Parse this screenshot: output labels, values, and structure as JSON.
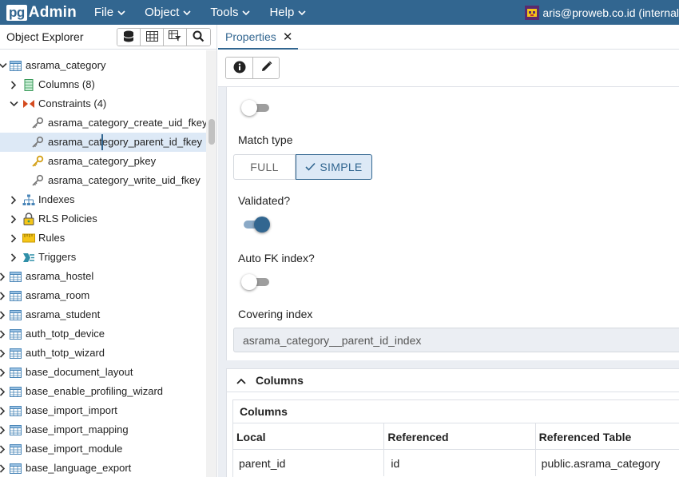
{
  "app": {
    "logo_pg": "pg",
    "logo_admin": "Admin"
  },
  "menu": [
    {
      "label": "File"
    },
    {
      "label": "Object"
    },
    {
      "label": "Tools"
    },
    {
      "label": "Help"
    }
  ],
  "user": {
    "label": "aris@proweb.co.id (internal"
  },
  "explorer": {
    "title": "Object Explorer",
    "tree": [
      {
        "label": "asrama_category",
        "indent": 0,
        "toggle": "open",
        "icon": "table-icon"
      },
      {
        "label": "Columns",
        "count": "(8)",
        "indent": 1,
        "toggle": "closed",
        "icon": "columns-icon"
      },
      {
        "label": "Constraints",
        "count": "(4)",
        "indent": 1,
        "toggle": "open",
        "icon": "constraints-icon"
      },
      {
        "label": "asrama_category_create_uid_fkey",
        "indent": 2,
        "toggle": "none",
        "icon": "foreign-key-icon"
      },
      {
        "label": "asrama_category_parent_id_fkey",
        "indent": 2,
        "toggle": "none",
        "icon": "foreign-key-icon",
        "selected": true
      },
      {
        "label": "asrama_category_pkey",
        "indent": 2,
        "toggle": "none",
        "icon": "primary-key-icon"
      },
      {
        "label": "asrama_category_write_uid_fkey",
        "indent": 2,
        "toggle": "none",
        "icon": "foreign-key-icon"
      },
      {
        "label": "Indexes",
        "indent": 1,
        "toggle": "closed",
        "icon": "indexes-icon"
      },
      {
        "label": "RLS Policies",
        "indent": 1,
        "toggle": "closed",
        "icon": "rls-policy-icon"
      },
      {
        "label": "Rules",
        "indent": 1,
        "toggle": "closed",
        "icon": "rules-icon"
      },
      {
        "label": "Triggers",
        "indent": 1,
        "toggle": "closed",
        "icon": "triggers-icon"
      },
      {
        "label": "asrama_hostel",
        "indent": 0,
        "toggle": "closed",
        "icon": "table-icon"
      },
      {
        "label": "asrama_room",
        "indent": 0,
        "toggle": "closed",
        "icon": "table-icon"
      },
      {
        "label": "asrama_student",
        "indent": 0,
        "toggle": "closed",
        "icon": "table-icon"
      },
      {
        "label": "auth_totp_device",
        "indent": 0,
        "toggle": "closed",
        "icon": "table-icon"
      },
      {
        "label": "auth_totp_wizard",
        "indent": 0,
        "toggle": "closed",
        "icon": "table-icon"
      },
      {
        "label": "base_document_layout",
        "indent": 0,
        "toggle": "closed",
        "icon": "table-icon"
      },
      {
        "label": "base_enable_profiling_wizard",
        "indent": 0,
        "toggle": "closed",
        "icon": "table-icon"
      },
      {
        "label": "base_import_import",
        "indent": 0,
        "toggle": "closed",
        "icon": "table-icon"
      },
      {
        "label": "base_import_mapping",
        "indent": 0,
        "toggle": "closed",
        "icon": "table-icon"
      },
      {
        "label": "base_import_module",
        "indent": 0,
        "toggle": "closed",
        "icon": "table-icon"
      },
      {
        "label": "base_language_export",
        "indent": 0,
        "toggle": "closed",
        "icon": "table-icon"
      }
    ]
  },
  "tab": {
    "label": "Properties"
  },
  "properties": {
    "deferred_toggle": false,
    "match_type_label": "Match type",
    "match_options": [
      "FULL",
      "SIMPLE"
    ],
    "match_selected": "SIMPLE",
    "validated_label": "Validated?",
    "validated": true,
    "auto_fk_label": "Auto FK index?",
    "auto_fk": false,
    "covering_label": "Covering index",
    "covering_value": "asrama_category__parent_id_index"
  },
  "columns_section": {
    "title": "Columns",
    "grid_title": "Columns",
    "headers": [
      "Local",
      "Referenced",
      "Referenced Table"
    ],
    "rows": [
      [
        "parent_id",
        "id",
        "public.asrama_category"
      ]
    ]
  },
  "colors": {
    "brand": "#326690",
    "selected_row": "#dde9f6",
    "panel_bg": "#ebeef3"
  }
}
